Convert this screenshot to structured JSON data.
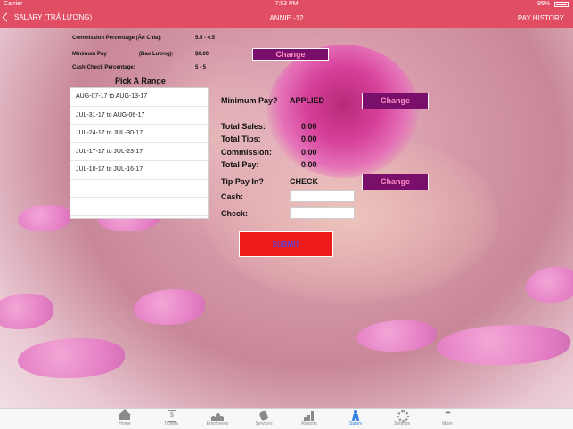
{
  "status_bar": {
    "carrier": "Carrier",
    "time": "7:53 PM",
    "battery": "95%"
  },
  "nav": {
    "back_label": "SALARY (TRẢ LƯƠNG)",
    "title": "ANNIE -12",
    "right_label": "PAY HISTORY"
  },
  "info": {
    "commission_label": "Commission Percentage (Ăn Chia):",
    "commission_value": "5.5 - 4.5",
    "min_pay_label": "Minimum Pay",
    "min_pay_sub_label": "(Bao Lương):",
    "min_pay_value": "$0.00",
    "cash_check_label": "Cash-Check Percentage:",
    "cash_check_value": "5 - 5",
    "change_label": "Change"
  },
  "range": {
    "title": "Pick A Range",
    "items": [
      "AUG-07-17 to AUG-13-17",
      "JUL-31-17 to AUG-06-17",
      "JUL-24-17 to JUL-30-17",
      "JUL-17-17 to JUL-23-17",
      "JUL-10-17 to JUL-16-17",
      "",
      ""
    ]
  },
  "summary": {
    "min_pay_q": "Minimum Pay?",
    "min_pay_status": "APPLIED",
    "change_label": "Change",
    "total_sales_label": "Total Sales:",
    "total_sales": "0.00",
    "total_tips_label": "Total Tips:",
    "total_tips": "0.00",
    "commission_label": "Commission:",
    "commission": "0.00",
    "total_pay_label": "Total Pay:",
    "total_pay": "0.00",
    "tip_pay_label": "Tip Pay In?",
    "tip_pay_value": "CHECK",
    "tip_change_label": "Change",
    "cash_label": "Cash:",
    "cash_value": "",
    "check_label": "Check:",
    "check_value": ""
  },
  "submit_label": "SUBMIT",
  "tabs": [
    {
      "label": "Home",
      "icon": "home-icon"
    },
    {
      "label": "Tickets",
      "icon": "ticket-icon"
    },
    {
      "label": "Employees",
      "icon": "people-icon"
    },
    {
      "label": "Services",
      "icon": "hand-icon"
    },
    {
      "label": "Reports",
      "icon": "bar-chart-icon"
    },
    {
      "label": "Salary",
      "icon": "salary-icon",
      "active": true
    },
    {
      "label": "Settings",
      "icon": "gear-icon"
    },
    {
      "label": "More",
      "icon": "more-icon"
    }
  ],
  "colors": {
    "accent": "#e14d63",
    "button": "#7a0f6b",
    "button_text": "#ff8fc6",
    "submit": "#ee1b1b",
    "active_tab": "#2f7de1"
  }
}
